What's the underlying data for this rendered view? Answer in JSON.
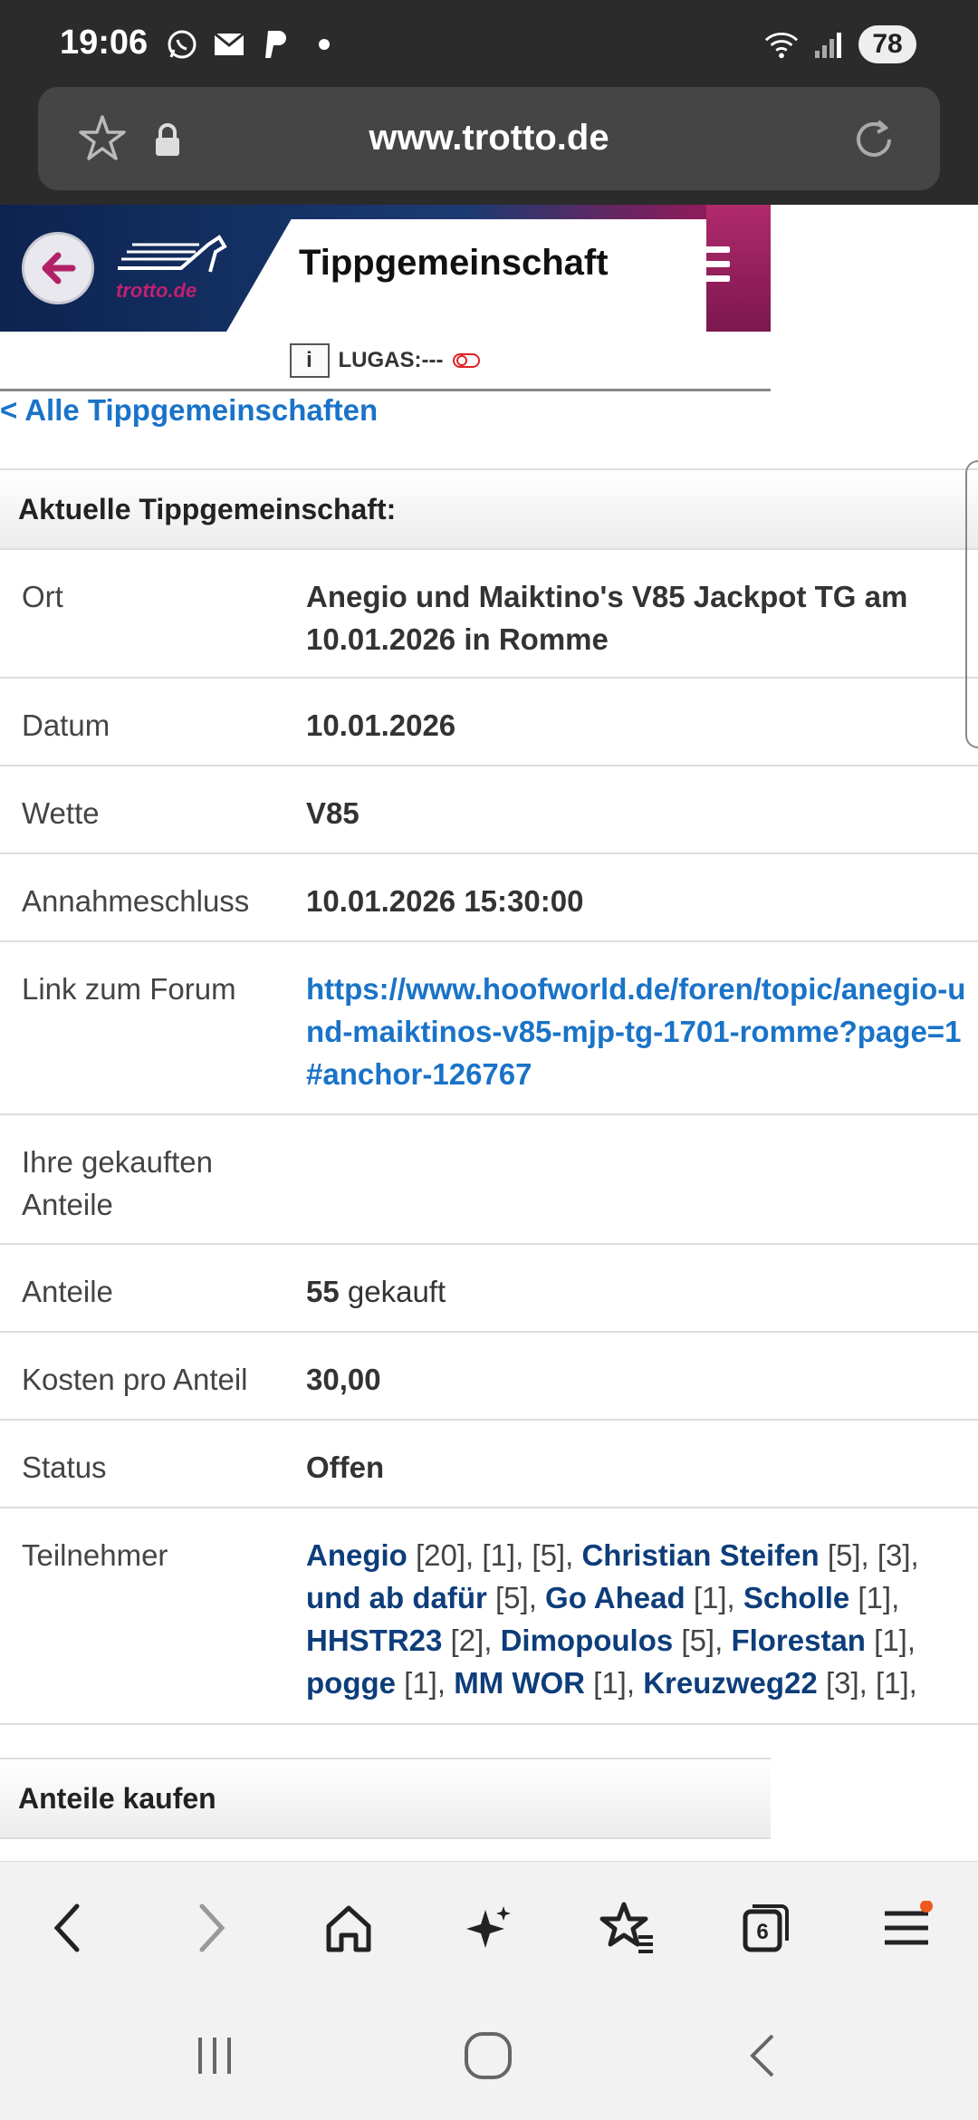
{
  "status_bar": {
    "time": "19:06",
    "battery": "78",
    "icons": [
      "whatsapp-icon",
      "mail-icon",
      "paypal-icon",
      "dot-icon",
      "wifi-icon",
      "signal-icon"
    ]
  },
  "browser": {
    "url": "www.trotto.de"
  },
  "site_header": {
    "logo_text": "trotto.de",
    "title": "Tippgemeinschaft"
  },
  "lugas": {
    "info_label": "i",
    "text": "LUGAS:---"
  },
  "back_link": "< Alle Tippgemeinschaften",
  "current_section": {
    "heading": "Aktuelle Tippgemeinschaft:",
    "rows": [
      {
        "label": "Ort",
        "value": "Anegio und Maiktino's V85 Jackpot TG am 10.01.2026 in Romme"
      },
      {
        "label": "Datum",
        "value": "10.01.2026"
      },
      {
        "label": "Wette",
        "value": "V85"
      },
      {
        "label": "Annahmeschluss",
        "value": "10.01.2026 15:30:00"
      },
      {
        "label": "Link zum Forum",
        "value": "https://www.hoofworld.de/foren/topic/anegio-und-maiktinos-v85-mjp-tg-1701-romme?page=1#anchor-126767"
      },
      {
        "label": "Ihre gekauften Anteile",
        "value": ""
      },
      {
        "label": "Anteile",
        "value": "55",
        "suffix": "gekauft"
      },
      {
        "label": "Kosten pro Anteil",
        "value": "30,00"
      },
      {
        "label": "Status",
        "value": "Offen"
      },
      {
        "label": "Teilnehmer",
        "value": ""
      }
    ],
    "participants": [
      {
        "name": "Anegio",
        "shares": "[20], [1], [5],"
      },
      {
        "name": "Christian Steifen",
        "shares": "[5], [3],"
      },
      {
        "name": "und ab dafür",
        "shares": "[5],"
      },
      {
        "name": "Go Ahead",
        "shares": "[1],"
      },
      {
        "name": "Scholle",
        "shares": "[1],"
      },
      {
        "name": "HHSTR23",
        "shares": "[2],"
      },
      {
        "name": "Dimopoulos",
        "shares": "[5],"
      },
      {
        "name": "Florestan",
        "shares": "[1],"
      },
      {
        "name": "pogge",
        "shares": "[1],"
      },
      {
        "name": "MM WOR",
        "shares": "[1],"
      },
      {
        "name": "Kreuzweg22",
        "shares": "[3], [1],"
      }
    ]
  },
  "buy_section": {
    "heading": "Anteile kaufen"
  },
  "toolbar": {
    "tabs_count": "6"
  }
}
